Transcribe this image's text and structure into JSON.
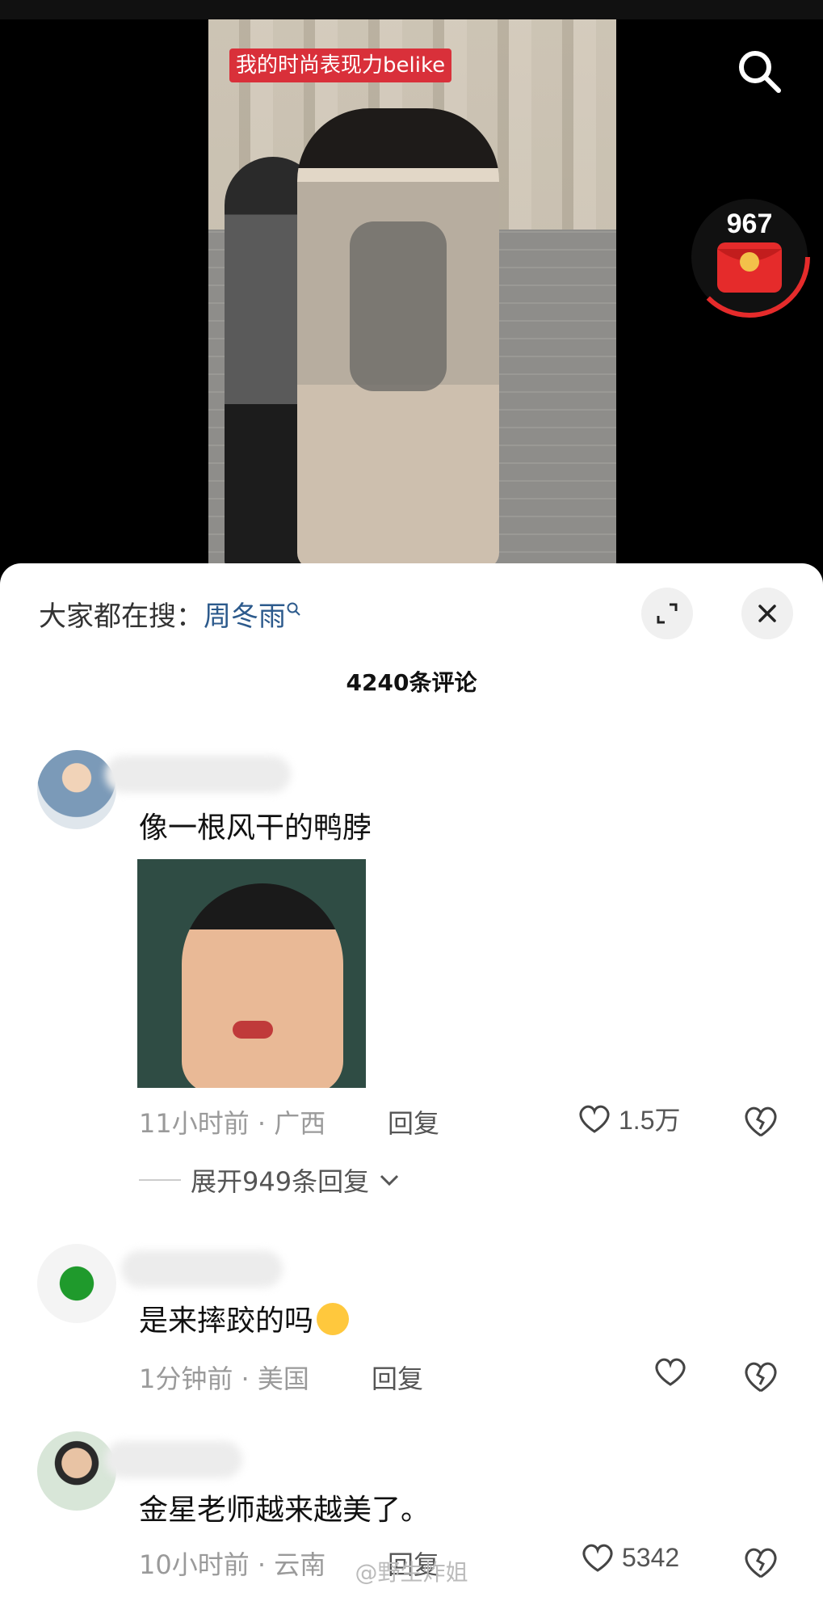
{
  "video": {
    "caption": "我的时尚表现力belike",
    "reward_count": "967"
  },
  "comments_panel": {
    "trending_prefix": "大家都在搜：",
    "trending_term": "周冬雨",
    "count_title": "4240条评论",
    "comments": [
      {
        "text": "像一根风干的鸭脖",
        "time": "11小时前",
        "location": "广西",
        "reply_label": "回复",
        "likes": "1.5万",
        "expand_label": "展开949条回复"
      },
      {
        "text": "是来摔跤的吗",
        "time": "1分钟前",
        "location": "美国",
        "reply_label": "回复",
        "likes": ""
      },
      {
        "text": "金星老师越来越美了。",
        "time": "10小时前",
        "location": "云南",
        "reply_label": "回复",
        "likes": "5342"
      }
    ],
    "watermark": "@野生炸姐"
  },
  "icons": {
    "search": "search-icon",
    "reward": "red-envelope-icon",
    "expand": "expand-icon",
    "close": "close-icon",
    "like": "heart-icon",
    "dislike": "broken-heart-icon",
    "chevron": "chevron-down-icon"
  },
  "colors": {
    "caption_bg": "#d9303a",
    "reward_red": "#e52b2b",
    "trending_term": "#2c5a8c"
  }
}
